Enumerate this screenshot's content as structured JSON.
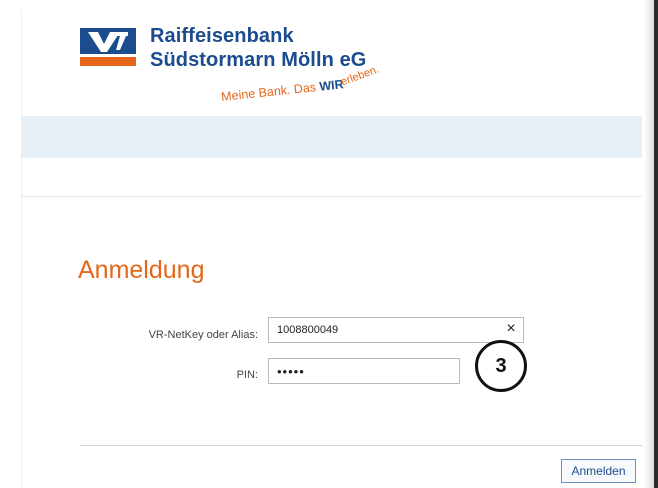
{
  "header": {
    "bank_name_line1": "Raiffeisenbank",
    "bank_name_line2": "Südstormarn Mölln eG",
    "slogan_part1": "Meine Bank. Das ",
    "slogan_wir": "WIR",
    "slogan_part2": " erleben."
  },
  "login": {
    "title": "Anmeldung",
    "username_label": "VR-NetKey oder Alias:",
    "username_value": "1008800049",
    "clear_icon": "×",
    "pin_label": "PIN:",
    "pin_value": "•••••",
    "submit_label": "Anmelden"
  },
  "annotation": {
    "step_number": "3"
  },
  "colors": {
    "brand_blue": "#1b4c8e",
    "brand_orange": "#e5661a",
    "nav_band": "#e6eef6"
  },
  "icons": {
    "logo": "volksbank-raiffeisenbank-logo",
    "clear": "close-icon"
  }
}
